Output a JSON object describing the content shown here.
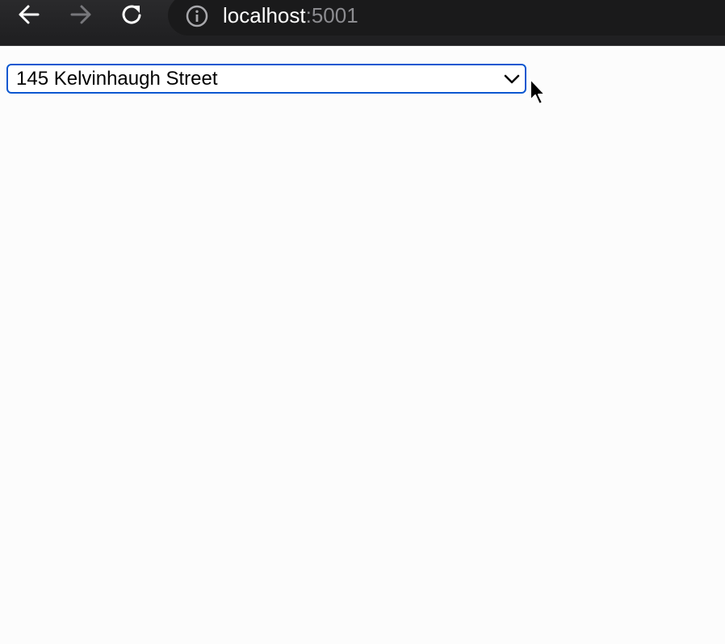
{
  "browser": {
    "url_host": "localhost",
    "url_port": ":5001",
    "back_icon": "arrow-left-icon",
    "forward_icon": "arrow-right-icon",
    "reload_icon": "reload-icon",
    "site_info_icon": "info-circle-icon"
  },
  "page": {
    "address_select": {
      "selected_value": "145 Kelvinhaugh Street",
      "dropdown_icon": "chevron-down-icon"
    }
  },
  "colors": {
    "toolbar": "#242426",
    "focus_ring": "#0b57d0",
    "page_background": "#fcfcfc"
  }
}
